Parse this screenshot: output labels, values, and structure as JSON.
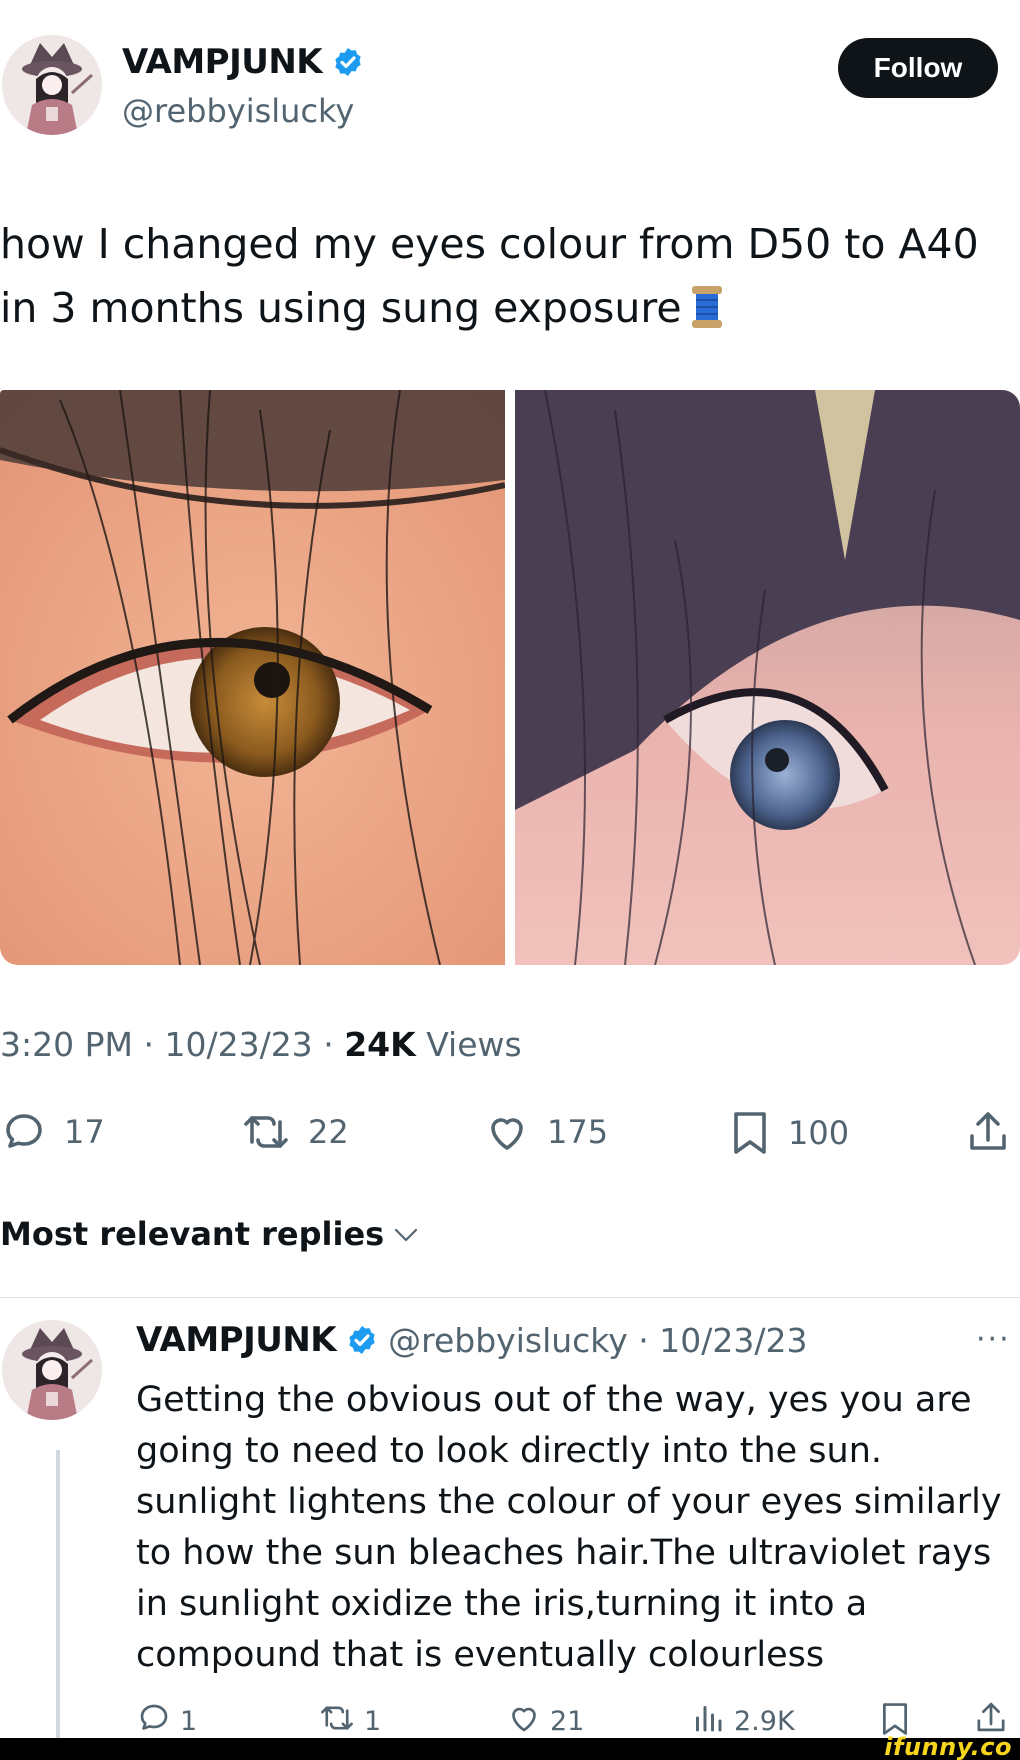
{
  "tweet": {
    "author_name": "VAMPJUNK",
    "author_handle": "@rebbyislucky",
    "follow_label": "Follow",
    "text": "how I changed my eyes colour from D50 to A40 in 3 months using sung exposure",
    "emoji": "spool-of-thread",
    "time": "3:20 PM",
    "date": "10/23/23",
    "views_count": "24K",
    "views_label": "Views",
    "separator": "·",
    "stats": {
      "replies": "17",
      "reposts": "22",
      "likes": "175",
      "bookmarks": "100"
    }
  },
  "replies_section": {
    "label": "Most relevant replies"
  },
  "reply": {
    "author_name": "VAMPJUNK",
    "handle_date": "@rebbyislucky · 10/23/23",
    "more_label": "···",
    "text": "Getting the obvious out of the way, yes you are going to need to look directly into the sun. sunlight lightens the colour of your eyes similarly to how the sun bleaches hair.The ultraviolet rays in sunlight oxidize the iris,turning it into a compound that is eventually colourless",
    "stats": {
      "replies": "1",
      "reposts": "1",
      "likes": "21",
      "views": "2.9K"
    }
  },
  "watermark": "ifunny.co",
  "colors": {
    "verified": "#1d9bf0",
    "text_secondary": "#536471",
    "text_primary": "#0f1419",
    "watermark": "#f7d51d"
  },
  "icons": [
    "reply-icon",
    "repost-icon",
    "like-icon",
    "bookmark-icon",
    "share-icon",
    "views-icon",
    "verified-icon",
    "chevron-down-icon"
  ]
}
